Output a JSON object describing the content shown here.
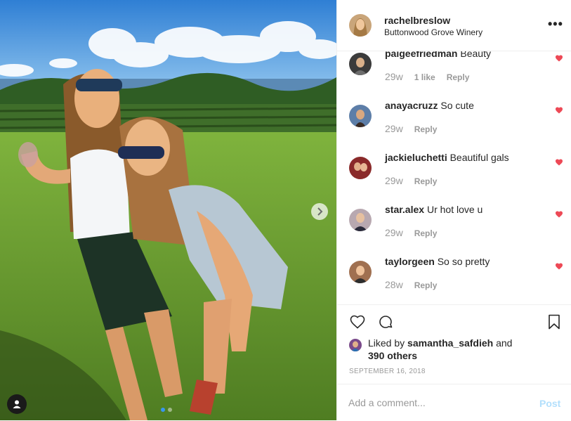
{
  "post": {
    "username": "rachelbreslow",
    "location": "Buttonwood Grove Winery",
    "more_label": "•••"
  },
  "comments": [
    {
      "user": "paigeefriedman",
      "text": "Beauty",
      "age": "29w",
      "likes": "1 like",
      "reply": "Reply",
      "avatar_color": "#3b3b3b"
    },
    {
      "user": "anayacruzz",
      "text": "So cute",
      "age": "29w",
      "likes": "",
      "reply": "Reply",
      "avatar_color": "#5d7ea8"
    },
    {
      "user": "jackieluchetti",
      "text": "Beautiful gals",
      "age": "29w",
      "likes": "",
      "reply": "Reply",
      "avatar_color": "#8a2a2a"
    },
    {
      "user": "star.alex",
      "text": "Ur hot love u",
      "age": "29w",
      "likes": "",
      "reply": "Reply",
      "avatar_color": "#b8a8b0"
    },
    {
      "user": "taylorgeen",
      "text": "So so pretty",
      "age": "28w",
      "likes": "",
      "reply": "Reply",
      "avatar_color": "#a07050"
    }
  ],
  "likes": {
    "prefix": "Liked by",
    "user": "samantha_safdieh",
    "and": "and",
    "others": "390 others"
  },
  "date": "SEPTEMBER 16, 2018",
  "add_comment": {
    "placeholder": "Add a comment...",
    "post_label": "Post"
  },
  "colors": {
    "heart": "#ed4956",
    "post_disabled": "#b2dffc",
    "carousel_active": "#3897f0"
  },
  "icons": {
    "actions": [
      "heart-outline-icon",
      "comment-bubble-icon",
      "bookmark-icon"
    ],
    "photo": [
      "chevron-right-icon",
      "user-tag-icon"
    ]
  }
}
